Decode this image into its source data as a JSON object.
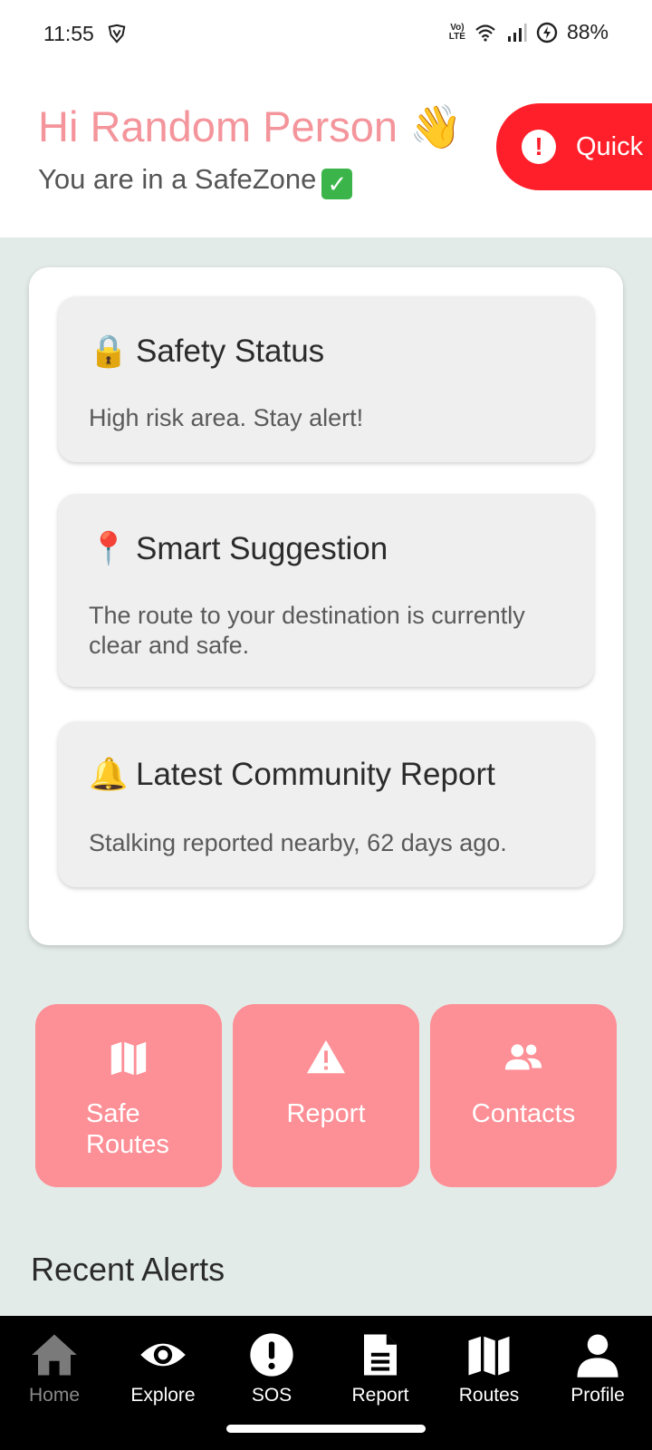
{
  "status_bar": {
    "time": "11:55",
    "lte_label_top": "Vo)",
    "lte_label_bottom": "LTE",
    "battery": "88%"
  },
  "header": {
    "greeting": "Hi Random Person",
    "greeting_emoji": "👋",
    "subtitle": "You are in a SafeZone",
    "subtitle_emoji": "✅",
    "quick_button_label": "Quick",
    "quick_button_icon": "!"
  },
  "cards": [
    {
      "emoji": "🔒",
      "title": "Safety Status",
      "body": "High risk area. Stay alert!"
    },
    {
      "emoji": "📍",
      "title": "Smart Suggestion",
      "body": "The route to your destination is currently clear and safe."
    },
    {
      "emoji": "🔔",
      "title": "Latest Community Report",
      "body": "Stalking reported nearby, 62 days ago."
    }
  ],
  "quick_actions": [
    {
      "label": "Safe Routes",
      "icon": "map-icon"
    },
    {
      "label": "Report",
      "icon": "warning-icon"
    },
    {
      "label": "Contacts",
      "icon": "users-icon"
    }
  ],
  "recent_alerts_title": "Recent Alerts",
  "nav": [
    {
      "label": "Home",
      "icon": "home-icon",
      "active": true
    },
    {
      "label": "Explore",
      "icon": "eye-icon"
    },
    {
      "label": "SOS",
      "icon": "alert-circle-icon"
    },
    {
      "label": "Report",
      "icon": "document-icon"
    },
    {
      "label": "Routes",
      "icon": "map-icon"
    },
    {
      "label": "Profile",
      "icon": "user-icon"
    }
  ],
  "colors": {
    "greeting": "#f4949b",
    "quick_button": "#ff1f2a",
    "action_buttons": "#fd8f96",
    "background": "#e3ebe8",
    "nav_background": "#000000"
  }
}
